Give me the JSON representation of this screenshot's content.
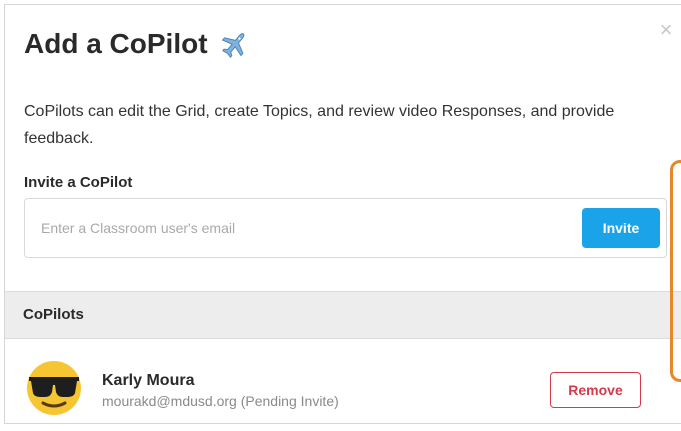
{
  "modal": {
    "title": "Add a CoPilot",
    "title_icon": "airplane-icon",
    "close_icon": "close-icon",
    "close_symbol": "×",
    "description": "CoPilots can edit the Grid, create Topics, and review video Responses, and provide feedback."
  },
  "invite": {
    "label": "Invite a CoPilot",
    "placeholder": "Enter a Classroom user's email",
    "value": "",
    "button_label": "Invite"
  },
  "copilots": {
    "section_title": "CoPilots",
    "items": [
      {
        "name": "Karly Moura",
        "email_status": "mourakd@mdusd.org (Pending Invite)",
        "avatar_icon": "sunglasses-emoji-icon",
        "remove_label": "Remove"
      }
    ]
  },
  "colors": {
    "accent_blue": "#1aa3e8",
    "danger_red": "#d33a4a",
    "highlight_orange": "#e8862a",
    "section_bg": "#ededed"
  }
}
